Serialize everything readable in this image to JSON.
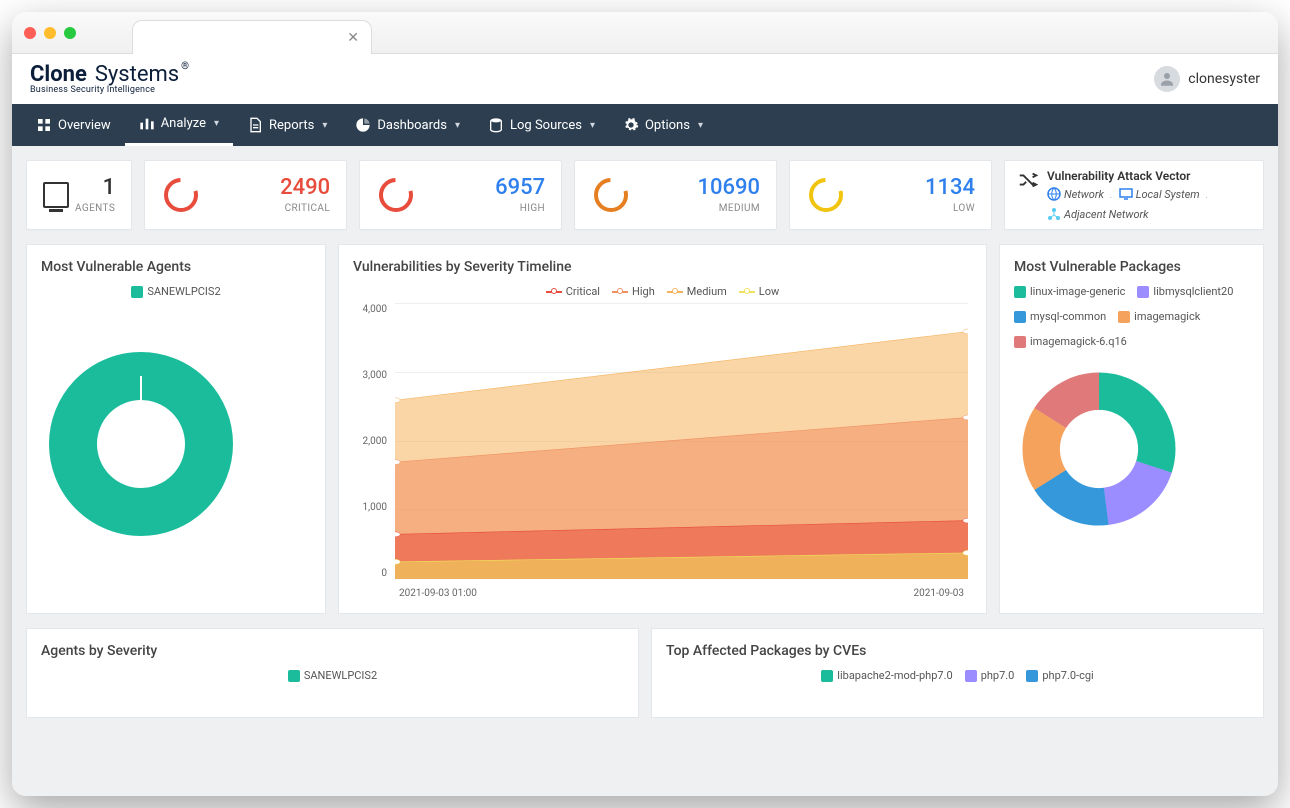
{
  "user": {
    "name": "clonesyster"
  },
  "brand": {
    "main1": "Clone",
    "main2": "Systems",
    "reg": "®",
    "sub": "Business Security Intelligence"
  },
  "nav": {
    "overview": "Overview",
    "analyze": "Analyze",
    "reports": "Reports",
    "dashboards": "Dashboards",
    "logsources": "Log Sources",
    "options": "Options"
  },
  "stats": {
    "agents": {
      "value": "1",
      "label": "AGENTS"
    },
    "critical": {
      "value": "2490",
      "label": "CRITICAL",
      "color": "#e74c3c"
    },
    "high": {
      "value": "6957",
      "label": "HIGH",
      "color": "#e67e22"
    },
    "medium": {
      "value": "10690",
      "label": "MEDIUM",
      "color": "#e67e22"
    },
    "low": {
      "value": "1134",
      "label": "LOW",
      "color": "#f1c40f"
    }
  },
  "vav": {
    "title": "Vulnerability Attack Vector",
    "items": [
      {
        "label": "Network",
        "color": "#2f80ed"
      },
      {
        "label": "Local System",
        "color": "#2f80ed"
      },
      {
        "label": "Adjacent Network",
        "color": "#56CCF2"
      }
    ]
  },
  "panels": {
    "mva": {
      "title": "Most Vulnerable Agents",
      "legend": [
        "SANEWLPCIS2"
      ]
    },
    "timeline": {
      "title": "Vulnerabilities by Severity Timeline"
    },
    "mvp": {
      "title": "Most Vulnerable Packages",
      "legend": [
        {
          "label": "linux-image-generic",
          "color": "#1abc9c"
        },
        {
          "label": "libmysqlclient20",
          "color": "#9b8cff"
        },
        {
          "label": "mysql-common",
          "color": "#3498db"
        },
        {
          "label": "imagemagick",
          "color": "#f5a25d"
        },
        {
          "label": "imagemagick-6.q16",
          "color": "#e07a7a"
        }
      ]
    },
    "abs": {
      "title": "Agents by Severity",
      "legend": [
        "SANEWLPCIS2"
      ]
    },
    "tap": {
      "title": "Top Affected Packages by CVEs",
      "legend": [
        {
          "label": "libapache2-mod-php7.0",
          "color": "#1abc9c"
        },
        {
          "label": "php7.0",
          "color": "#9b8cff"
        },
        {
          "label": "php7.0-cgi",
          "color": "#3498db"
        }
      ]
    }
  },
  "chart_data": [
    {
      "id": "severity_timeline",
      "type": "area",
      "x": [
        "2021-09-03 01:00",
        "2021-09-03"
      ],
      "series": [
        {
          "name": "Critical",
          "color": "#e74c3c",
          "values": [
            650,
            850
          ]
        },
        {
          "name": "High",
          "color": "#f09060",
          "values": [
            1700,
            2350
          ]
        },
        {
          "name": "Medium",
          "color": "#f5b25d",
          "values": [
            2600,
            3600
          ]
        },
        {
          "name": "Low",
          "color": "#f1e05a",
          "values": [
            250,
            380
          ]
        }
      ],
      "ylim": [
        0,
        4000
      ],
      "yticks": [
        0,
        1000,
        2000,
        3000,
        4000
      ],
      "xlabel": "",
      "ylabel": "",
      "title": "Vulnerabilities by Severity Timeline"
    },
    {
      "id": "most_vulnerable_agents",
      "type": "pie",
      "title": "Most Vulnerable Agents",
      "series": [
        {
          "name": "SANEWLPCIS2",
          "value": 100,
          "color": "#1abc9c"
        }
      ]
    },
    {
      "id": "most_vulnerable_packages",
      "type": "pie",
      "title": "Most Vulnerable Packages",
      "series": [
        {
          "name": "linux-image-generic",
          "value": 30,
          "color": "#1abc9c"
        },
        {
          "name": "libmysqlclient20",
          "value": 18,
          "color": "#9b8cff"
        },
        {
          "name": "mysql-common",
          "value": 18,
          "color": "#3498db"
        },
        {
          "name": "imagemagick",
          "value": 18,
          "color": "#f5a25d"
        },
        {
          "name": "imagemagick-6.q16",
          "value": 16,
          "color": "#e07a7a"
        }
      ]
    }
  ]
}
